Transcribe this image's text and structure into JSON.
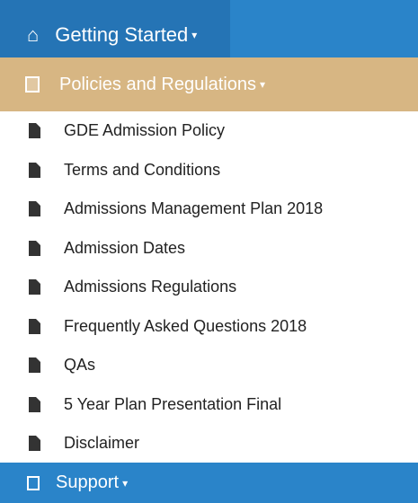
{
  "nav": {
    "getting_started": {
      "label": "Getting Started",
      "icon": "home-icon"
    },
    "policies": {
      "label": "Policies and Regulations",
      "icon": "document-icon"
    },
    "support": {
      "label": "Support",
      "icon": "box-icon"
    }
  },
  "menu": {
    "items": [
      "GDE Admission Policy",
      "Terms and Conditions",
      "Admissions Management Plan 2018",
      "Admission Dates",
      "Admissions Regulations",
      "Frequently Asked Questions 2018",
      "QAs",
      "5 Year Plan Presentation Final",
      "Disclaimer"
    ]
  },
  "colors": {
    "primary": "#2a84c9",
    "accent": "#d7b683"
  }
}
